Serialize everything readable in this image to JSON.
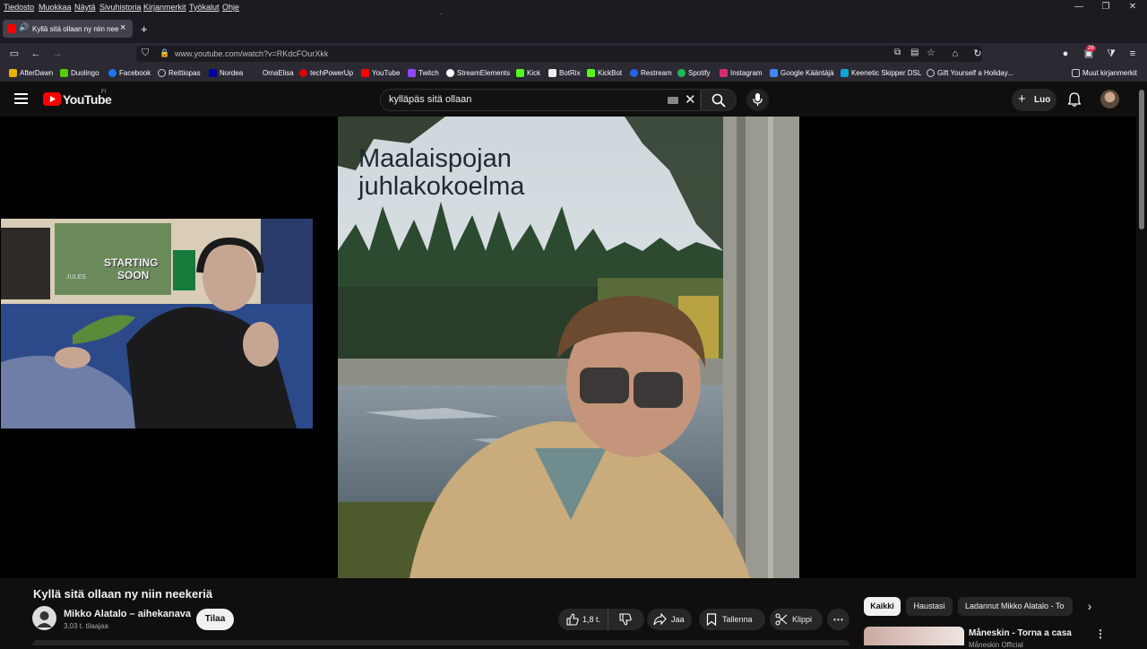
{
  "menubar": {
    "items": [
      "Tiedosto",
      "Muokkaa",
      "Näytä",
      "Sivuhistoria",
      "Kirjanmerkit",
      "Työkalut",
      "Ohje"
    ]
  },
  "tab": {
    "title": "Kyllä sitä ollaan ny niin neekeriä",
    "close": "×"
  },
  "new_tab": "+",
  "urlbar": {
    "url": "www.youtube.com/watch?v=RKdcFOurXkk"
  },
  "extension_badge": "29",
  "bookmarks": {
    "items": [
      "AfterDawn",
      "Duolingo",
      "Facebook",
      "Reittiopas",
      "Nordea",
      "OmaElisa",
      "techPowerUp",
      "YouTube",
      "Twitch",
      "StreamElements",
      "Kick",
      "BotRix",
      "KickBot",
      "Restream",
      "Spotify",
      "Instagram",
      "Google Kääntäjä",
      "Keenetic Skipper DSL",
      "Gift Yourself a Holiday..."
    ],
    "other": "Muut kirjanmerkit"
  },
  "youtube": {
    "logo_text": "YouTube",
    "region": "FI",
    "search_value": "kylläpäs sitä ollaan",
    "create_label": "Luo"
  },
  "album_cover": {
    "title_line1": "Maalaispojan",
    "title_line2": "juhlakokoelma"
  },
  "webcam": {
    "poster_text1": "STARTING",
    "poster_text2": "SOON",
    "poster_small": "JULES"
  },
  "video_info": {
    "title": "Kyllä sitä ollaan ny niin neekeriä",
    "channel": "Mikko Alatalo – aihekanava",
    "subscribers": "3,03 t. tilaajaa",
    "subscribe_label": "Tilaa",
    "likes": "1,8 t.",
    "share_label": "Jaa",
    "save_label": "Tallenna",
    "clip_label": "Klippi",
    "more": "⋯"
  },
  "filters": {
    "chips": [
      "Kaikki",
      "Haustasi",
      "Ladannut Mikko Alatalo - To"
    ]
  },
  "recommendation": {
    "title": "Måneskin - Torna a casa",
    "channel": "Måneskin Official"
  },
  "colors": {
    "accent_red": "#ff0000",
    "bg": "#0f0f0f",
    "chip_active": "#f1f1f1"
  }
}
